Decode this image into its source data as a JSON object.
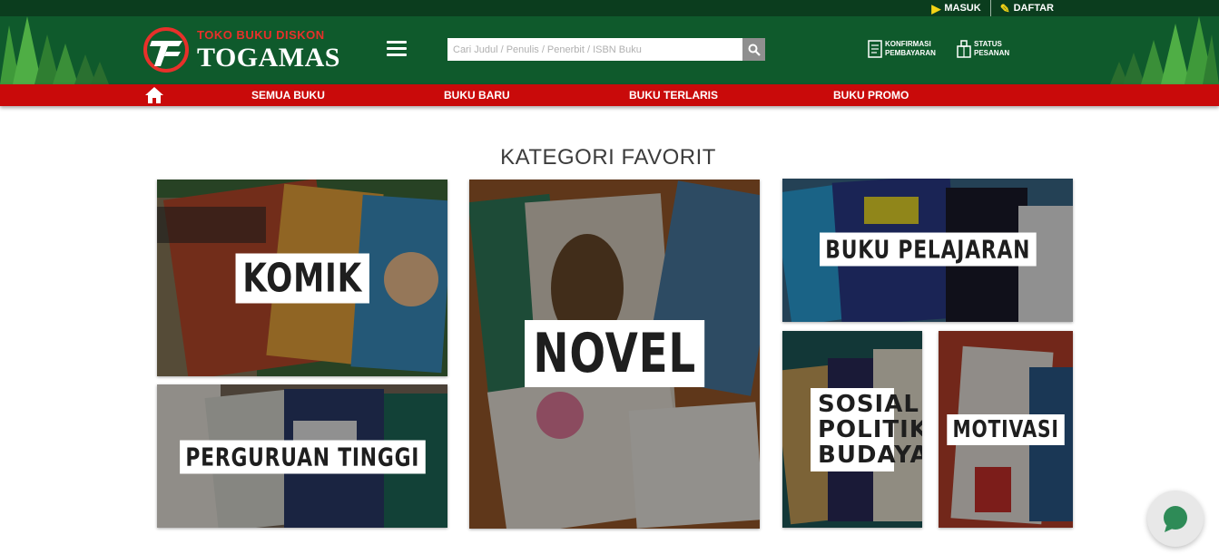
{
  "topbar": {
    "login_label": "MASUK",
    "register_label": "DAFTAR"
  },
  "header": {
    "logo_tagline": "TOKO BUKU DISKON",
    "logo_name": "TOGAMAS",
    "search_placeholder": "Cari Judul / Penulis / Penerbit / ISBN Buku",
    "confirm_payment": [
      "KONFIRMASI",
      "PEMBAYARAN"
    ],
    "order_status": [
      "STATUS",
      "PESANAN"
    ]
  },
  "nav": {
    "items": [
      "SEMUA BUKU",
      "BUKU BARU",
      "BUKU TERLARIS",
      "BUKU PROMO"
    ]
  },
  "main": {
    "section_title": "KATEGORI FAVORIT",
    "categories": {
      "komik": "KOMIK",
      "perguruan_tinggi": "PERGURUAN TINGGI",
      "novel": "NOVEL",
      "buku_pelajaran": "BUKU PELAJARAN",
      "sosial_politik_budaya": [
        "SOSIAL",
        "POLITIK",
        "BUDAYA"
      ],
      "motivasi": "MOTIVASI"
    }
  },
  "colors": {
    "topbar": "#0b3d1e",
    "header": "#0f5a2c",
    "nav": "#c90a0a",
    "accent_yellow": "#f3d416",
    "chat_green": "#2e8b57"
  },
  "icons": {
    "login": "play-circle-icon",
    "register": "edit-icon",
    "search": "search-icon",
    "menu": "hamburger-icon",
    "home": "home-icon",
    "confirm": "receipt-icon",
    "status": "package-icon",
    "chat": "chat-bubble-icon"
  }
}
